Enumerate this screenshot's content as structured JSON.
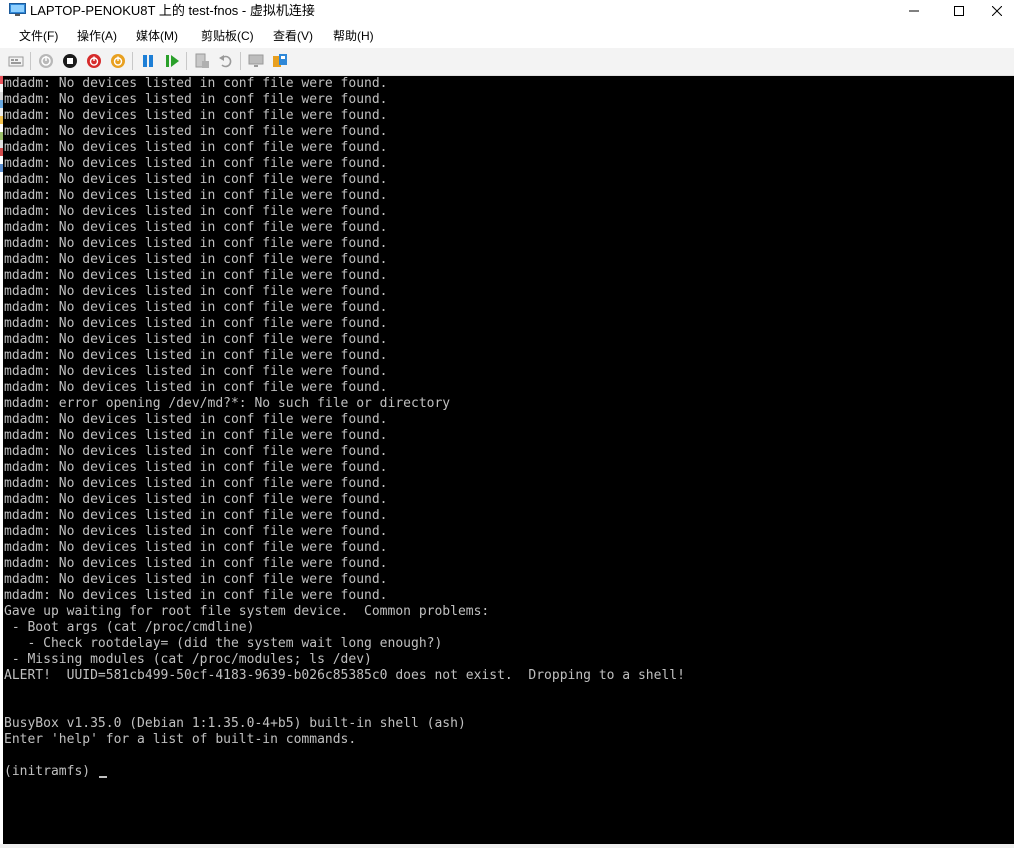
{
  "window": {
    "title": "LAPTOP-PENOKU8T 上的 test-fnos - 虚拟机连接",
    "minimize": "minimize",
    "maximize": "maximize",
    "close": "close"
  },
  "menu": [
    {
      "label": "文件(F)"
    },
    {
      "label": "操作(A)"
    },
    {
      "label": "媒体(M)"
    },
    {
      "label": "剪贴板(C)"
    },
    {
      "label": "查看(V)"
    },
    {
      "label": "帮助(H)"
    }
  ],
  "toolbar": [
    {
      "icon": "ctrl-alt-del-icon",
      "enabled": false
    },
    {
      "icon": "start-icon",
      "enabled": false
    },
    {
      "icon": "turn-off-icon",
      "enabled": true,
      "color": "#1a1a1a"
    },
    {
      "icon": "shutdown-icon",
      "enabled": true,
      "color": "#d62b2b"
    },
    {
      "icon": "power-icon",
      "enabled": true,
      "color": "#e8a020"
    },
    {
      "icon": "pause-icon",
      "enabled": true,
      "color": "#1e7fd6"
    },
    {
      "icon": "resume-icon",
      "enabled": true,
      "color": "#2aa02a"
    },
    {
      "icon": "checkpoint-icon",
      "enabled": false
    },
    {
      "icon": "revert-icon",
      "enabled": false
    },
    {
      "icon": "enhanced-session-icon",
      "enabled": false
    },
    {
      "icon": "share-icon",
      "enabled": true
    }
  ],
  "terminal": {
    "background": "#000000",
    "foreground": "#c0c0c0",
    "lines": [
      "mdadm: No devices listed in conf file were found.",
      "mdadm: No devices listed in conf file were found.",
      "mdadm: No devices listed in conf file were found.",
      "mdadm: No devices listed in conf file were found.",
      "mdadm: No devices listed in conf file were found.",
      "mdadm: No devices listed in conf file were found.",
      "mdadm: No devices listed in conf file were found.",
      "mdadm: No devices listed in conf file were found.",
      "mdadm: No devices listed in conf file were found.",
      "mdadm: No devices listed in conf file were found.",
      "mdadm: No devices listed in conf file were found.",
      "mdadm: No devices listed in conf file were found.",
      "mdadm: No devices listed in conf file were found.",
      "mdadm: No devices listed in conf file were found.",
      "mdadm: No devices listed in conf file were found.",
      "mdadm: No devices listed in conf file were found.",
      "mdadm: No devices listed in conf file were found.",
      "mdadm: No devices listed in conf file were found.",
      "mdadm: No devices listed in conf file were found.",
      "mdadm: No devices listed in conf file were found.",
      "mdadm: error opening /dev/md?*: No such file or directory",
      "mdadm: No devices listed in conf file were found.",
      "mdadm: No devices listed in conf file were found.",
      "mdadm: No devices listed in conf file were found.",
      "mdadm: No devices listed in conf file were found.",
      "mdadm: No devices listed in conf file were found.",
      "mdadm: No devices listed in conf file were found.",
      "mdadm: No devices listed in conf file were found.",
      "mdadm: No devices listed in conf file were found.",
      "mdadm: No devices listed in conf file were found.",
      "mdadm: No devices listed in conf file were found.",
      "mdadm: No devices listed in conf file were found.",
      "mdadm: No devices listed in conf file were found.",
      "Gave up waiting for root file system device.  Common problems:",
      " - Boot args (cat /proc/cmdline)",
      "   - Check rootdelay= (did the system wait long enough?)",
      " - Missing modules (cat /proc/modules; ls /dev)",
      "ALERT!  UUID=581cb499-50cf-4183-9639-b026c85385c0 does not exist.  Dropping to a shell!",
      "",
      "",
      "BusyBox v1.35.0 (Debian 1:1.35.0-4+b5) built-in shell (ash)",
      "Enter 'help' for a list of built-in commands.",
      "",
      "(initramfs) "
    ]
  }
}
